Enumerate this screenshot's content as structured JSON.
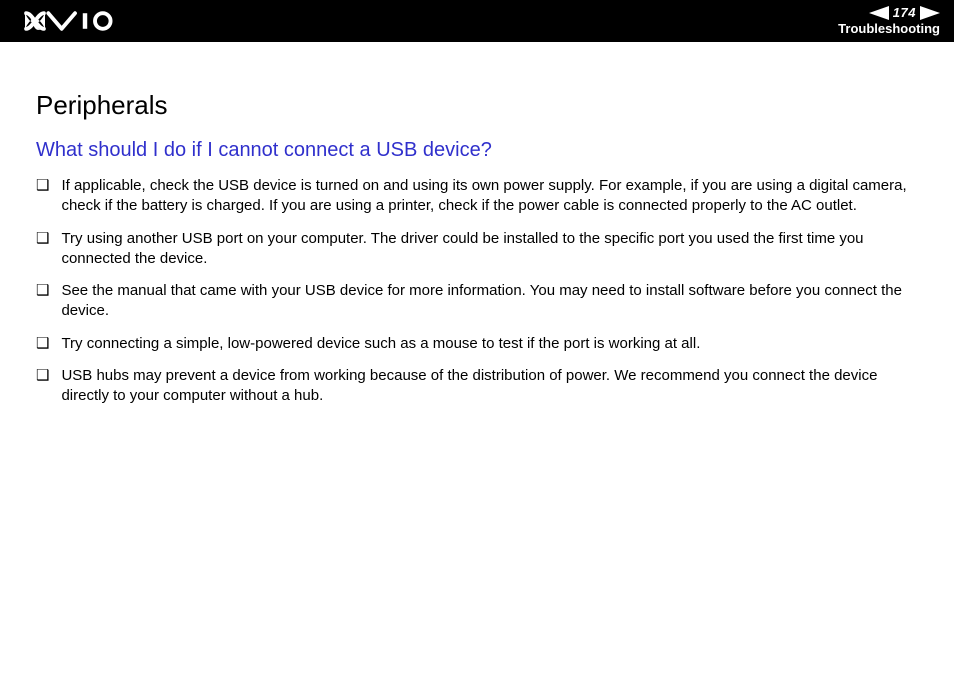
{
  "header": {
    "page_number": "174",
    "section": "Troubleshooting",
    "logo_alt": "VAIO"
  },
  "content": {
    "heading": "Peripherals",
    "question": "What should I do if I cannot connect a USB device?",
    "bullets": [
      "If applicable, check the USB device is turned on and using its own power supply. For example, if you are using a digital camera, check if the battery is charged. If you are using a printer, check if the power cable is connected properly to the AC outlet.",
      "Try using another USB port on your computer. The driver could be installed to the specific port you used the first time you connected the device.",
      "See the manual that came with your USB device for more information. You may need to install software before you connect the device.",
      "Try connecting a simple, low-powered device such as a mouse to test if the port is working at all.",
      "USB hubs may prevent a device from working because of the distribution of power. We recommend you connect the device directly to your computer without a hub."
    ]
  }
}
